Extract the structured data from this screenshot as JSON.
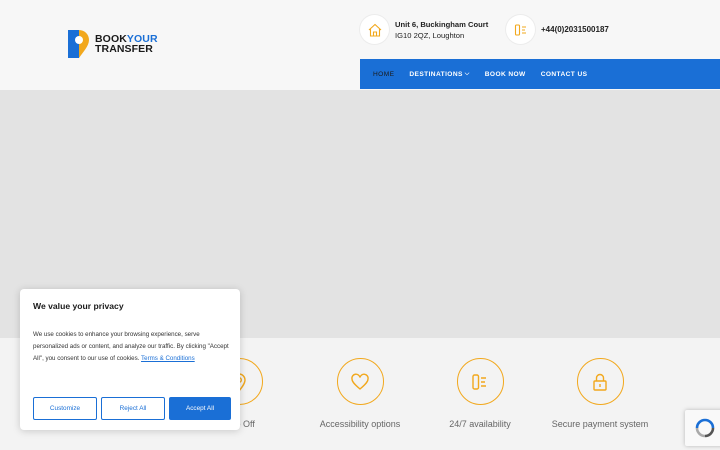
{
  "logo": {
    "line1_a": "BOOK",
    "line1_b": "YOUR",
    "line2": "TRANSFER"
  },
  "header": {
    "address_line1": "Unit 6, Buckingham Court",
    "address_line2": "IG10 2QZ, Loughton",
    "phone": "+44(0)2031500187"
  },
  "nav": {
    "items": [
      {
        "label": "HOME"
      },
      {
        "label": "DESTINATIONS"
      },
      {
        "label": "BOOK NOW"
      },
      {
        "label": "CONTACT US"
      }
    ]
  },
  "features": [
    {
      "label": "Drop Off",
      "icon": "map-pin-icon"
    },
    {
      "label": "Accessibility options",
      "icon": "heart-icon"
    },
    {
      "label": "24/7 availability",
      "icon": "phone-icon"
    },
    {
      "label": "Secure payment system",
      "icon": "lock-icon"
    }
  ],
  "cookie": {
    "title": "We value your privacy",
    "body": "We use cookies to enhance your browsing experience, serve personalized ads or content, and analyze our traffic. By clicking \"Accept All\", you consent to our use of cookies.",
    "link": "Terms & Conditions",
    "customize": "Customize",
    "reject": "Reject All",
    "accept": "Accept All"
  },
  "colors": {
    "brand_blue": "#1a6fd6",
    "accent_orange": "#f2a81d"
  }
}
